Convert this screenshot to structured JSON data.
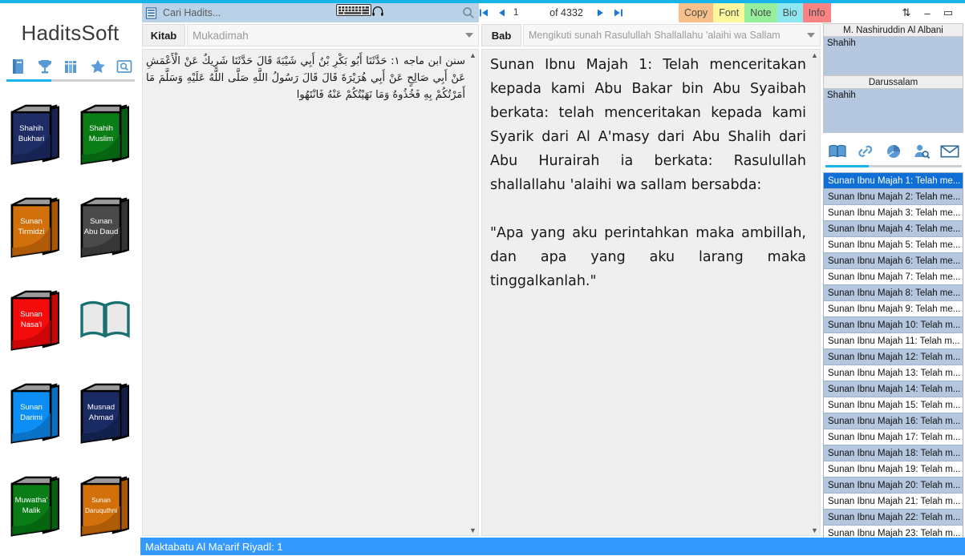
{
  "app": {
    "brand": "HaditsSoft",
    "nav_icons": [
      "book-icon",
      "trophy-icon",
      "library-icon",
      "star-icon",
      "browse-icon"
    ]
  },
  "sidebar": {
    "books": [
      {
        "title_line1": "Shahih",
        "title_line2": "Bukhari",
        "color": "#1f2d66",
        "shade": "#16224f"
      },
      {
        "title_line1": "Shahih",
        "title_line2": "Muslim",
        "color": "#0a7d17",
        "shade": "#066011"
      },
      {
        "title_line1": "Sunan",
        "title_line2": "Tirmidzi",
        "color": "#d2700b",
        "shade": "#a95707"
      },
      {
        "title_line1": "Sunan",
        "title_line2": "Abu Daud",
        "color": "#4a4a4a",
        "shade": "#343434"
      },
      {
        "title_line1": "Sunan",
        "title_line2": "Nasa'i",
        "color": "#f40b0b",
        "shade": "#c50707"
      },
      {
        "title_line1": "",
        "title_line2": "",
        "color": "#e9e9e9",
        "shade": "#1a6f6f",
        "open_book": true
      },
      {
        "title_line1": "Sunan",
        "title_line2": "Darimi",
        "color": "#0d8ef5",
        "shade": "#0a6fc0"
      },
      {
        "title_line1": "Musnad",
        "title_line2": "Ahmad",
        "color": "#1a2a63",
        "shade": "#121e48"
      },
      {
        "title_line1": "Muwatha'",
        "title_line2": "Malik",
        "color": "#0a7d17",
        "shade": "#066011"
      },
      {
        "title_line1": "Sunan",
        "title_line2": "Daruquthni",
        "color": "#d2700b",
        "shade": "#a95707"
      }
    ]
  },
  "search": {
    "placeholder": "Cari Hadits...",
    "value": "",
    "hamburger_icon": "menu-icon",
    "search_icon": "search-icon",
    "keyboard_icon": "keyboard-icon",
    "headphone_icon": "headphone-icon"
  },
  "pager": {
    "first_label": "|◀",
    "prev_label": "◀",
    "current_page": "1",
    "of_label": "of 4332",
    "next_label": "▶",
    "last_label": "▶|"
  },
  "actions": [
    {
      "label": "Copy",
      "color": "#f7c08a"
    },
    {
      "label": "Font",
      "color": "#fbf79a"
    },
    {
      "label": "Note",
      "color": "#96ef9c"
    },
    {
      "label": "Bio",
      "color": "#8fe7f2"
    },
    {
      "label": "Info",
      "color": "#f98282"
    }
  ],
  "window_controls": {
    "sort_label": "⇅",
    "minimize_label": "–",
    "maximize_label": "▭",
    "close_label": "✕"
  },
  "selectors": {
    "kitab_label": "Kitab",
    "kitab_value": "Mukadimah",
    "bab_label": "Bab",
    "bab_value": "Mengikuti sunah Rasulullah Shallallahu 'alaihi wa Sallam"
  },
  "arabic": {
    "text": "سنن ابن ماجه ١: حَدَّثَنَا أَبُو بَكْرِ بْنُ أَبِي شَيْبَةَ قَالَ حَدَّثَنَا شَرِيكٌ عَنْ الْأَعْمَشِ عَنْ أَبِي صَالِحٍ عَنْ أَبِي هُرَيْرَةَ قَالَ قَالَ رَسُولُ اللَّهِ صَلَّى اللَّهُ عَلَيْهِ وَسَلَّمَ مَا أَمَرْتُكُمْ بِهِ فَخُذُوهُ وَمَا نَهَيْتُكُمْ عَنْهُ فَانْتَهُوا"
  },
  "translation": {
    "paragraph1": "Sunan Ibnu Majah 1: Telah menceritakan kepada kami Abu Bakar bin Abu Syaibah berkata: telah menceritakan kepada kami Syarik dari Al A'masy dari Abu Shalih dari Abu Hurairah ia berkata: Rasulullah shallallahu 'alaihi wa sallam bersabda:",
    "paragraph2": "\"Apa yang aku perintahkan maka ambillah, dan apa yang aku larang maka tinggalkanlah.\""
  },
  "grading": {
    "blocks": [
      {
        "header": "M. Nashiruddin Al Albani",
        "value": "Shahih"
      },
      {
        "header": "Darussalam",
        "value": "Shahih"
      }
    ],
    "icons": [
      "book-open-icon",
      "link-icon",
      "chart-pie-icon",
      "person-search-icon",
      "mail-icon"
    ]
  },
  "hadith_list": {
    "items": [
      {
        "label": "Sunan Ibnu Majah 1: Telah me...",
        "selected": true
      },
      {
        "label": "Sunan Ibnu Majah 2: Telah me...",
        "selected": false
      },
      {
        "label": "Sunan Ibnu Majah 3: Telah me...",
        "selected": false
      },
      {
        "label": "Sunan Ibnu Majah 4: Telah me...",
        "selected": false
      },
      {
        "label": "Sunan Ibnu Majah 5: Telah me...",
        "selected": false
      },
      {
        "label": "Sunan Ibnu Majah 6: Telah me...",
        "selected": false
      },
      {
        "label": "Sunan Ibnu Majah 7: Telah me...",
        "selected": false
      },
      {
        "label": "Sunan Ibnu Majah 8: Telah me...",
        "selected": false
      },
      {
        "label": "Sunan Ibnu Majah 9: Telah me...",
        "selected": false
      },
      {
        "label": "Sunan Ibnu Majah 10: Telah m...",
        "selected": false
      },
      {
        "label": "Sunan Ibnu Majah 11: Telah m...",
        "selected": false
      },
      {
        "label": "Sunan Ibnu Majah 12: Telah m...",
        "selected": false
      },
      {
        "label": "Sunan Ibnu Majah 13: Telah m...",
        "selected": false
      },
      {
        "label": "Sunan Ibnu Majah 14: Telah m...",
        "selected": false
      },
      {
        "label": "Sunan Ibnu Majah 15: Telah m...",
        "selected": false
      },
      {
        "label": "Sunan Ibnu Majah 16: Telah m...",
        "selected": false
      },
      {
        "label": "Sunan Ibnu Majah 17: Telah m...",
        "selected": false
      },
      {
        "label": "Sunan Ibnu Majah 18: Telah m...",
        "selected": false
      },
      {
        "label": "Sunan Ibnu Majah 19: Telah m...",
        "selected": false
      },
      {
        "label": "Sunan Ibnu Majah 20: Telah m...",
        "selected": false
      },
      {
        "label": "Sunan Ibnu Majah 21: Telah m...",
        "selected": false
      },
      {
        "label": "Sunan Ibnu Majah 22: Telah m...",
        "selected": false
      },
      {
        "label": "Sunan Ibnu Majah 23: Telah m...",
        "selected": false
      }
    ]
  },
  "status_bar": {
    "text": "Maktabatu Al Ma'arif Riyadl:  1"
  }
}
